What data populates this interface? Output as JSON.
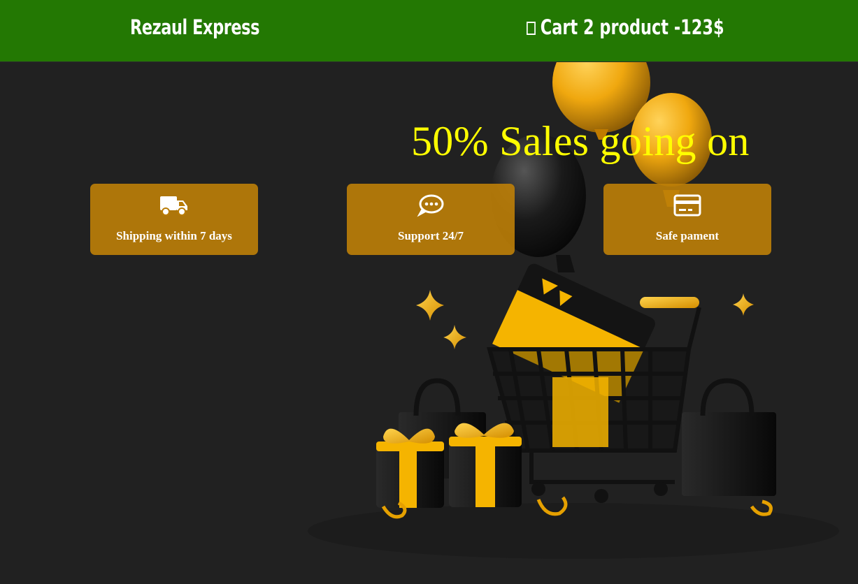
{
  "header": {
    "brand": "Rezaul Express",
    "cart_text": "Cart 2 product -123$",
    "cart_icon": "cart-icon"
  },
  "hero": {
    "headline": "50% Sales going on",
    "headline_color": "#ffff00"
  },
  "features": [
    {
      "label": "Shipping within 7 days",
      "icon": "truck-icon"
    },
    {
      "label": "Support 24/7",
      "icon": "chat-icon"
    },
    {
      "label": "Safe pament",
      "icon": "credit-card-icon"
    }
  ],
  "colors": {
    "header_bg": "#237803",
    "page_bg": "#212121",
    "card_bg": "#be8008",
    "accent_gold": "#f5b400"
  }
}
